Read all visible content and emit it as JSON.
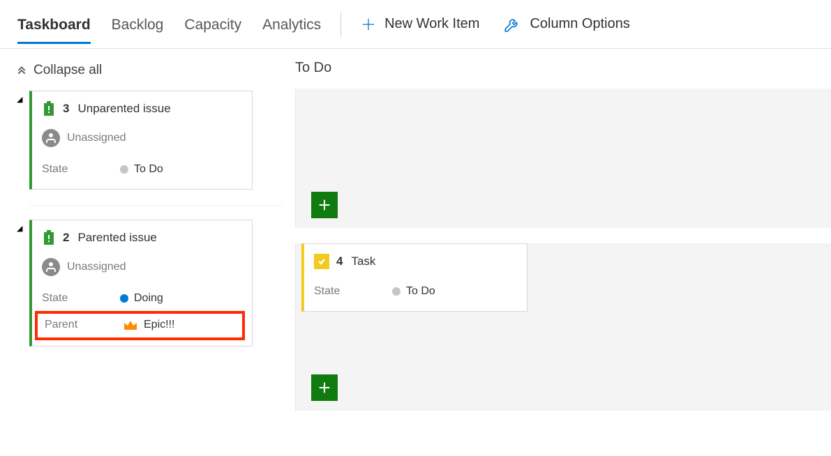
{
  "tabs": {
    "taskboard": "Taskboard",
    "backlog": "Backlog",
    "capacity": "Capacity",
    "analytics": "Analytics"
  },
  "actions": {
    "new_work_item": "New Work Item",
    "column_options": "Column Options"
  },
  "sidebar": {
    "collapse_all": "Collapse all",
    "cards": [
      {
        "id": "3",
        "title": "Unparented issue",
        "assignee": "Unassigned",
        "state_label": "State",
        "state_value": "To Do",
        "state_color": "gray"
      },
      {
        "id": "2",
        "title": "Parented issue",
        "assignee": "Unassigned",
        "state_label": "State",
        "state_value": "Doing",
        "state_color": "blue",
        "parent_label": "Parent",
        "parent_value": "Epic!!!"
      }
    ]
  },
  "column": {
    "header": "To Do",
    "task": {
      "id": "4",
      "title": "Task",
      "state_label": "State",
      "state_value": "To Do",
      "state_color": "gray"
    }
  }
}
